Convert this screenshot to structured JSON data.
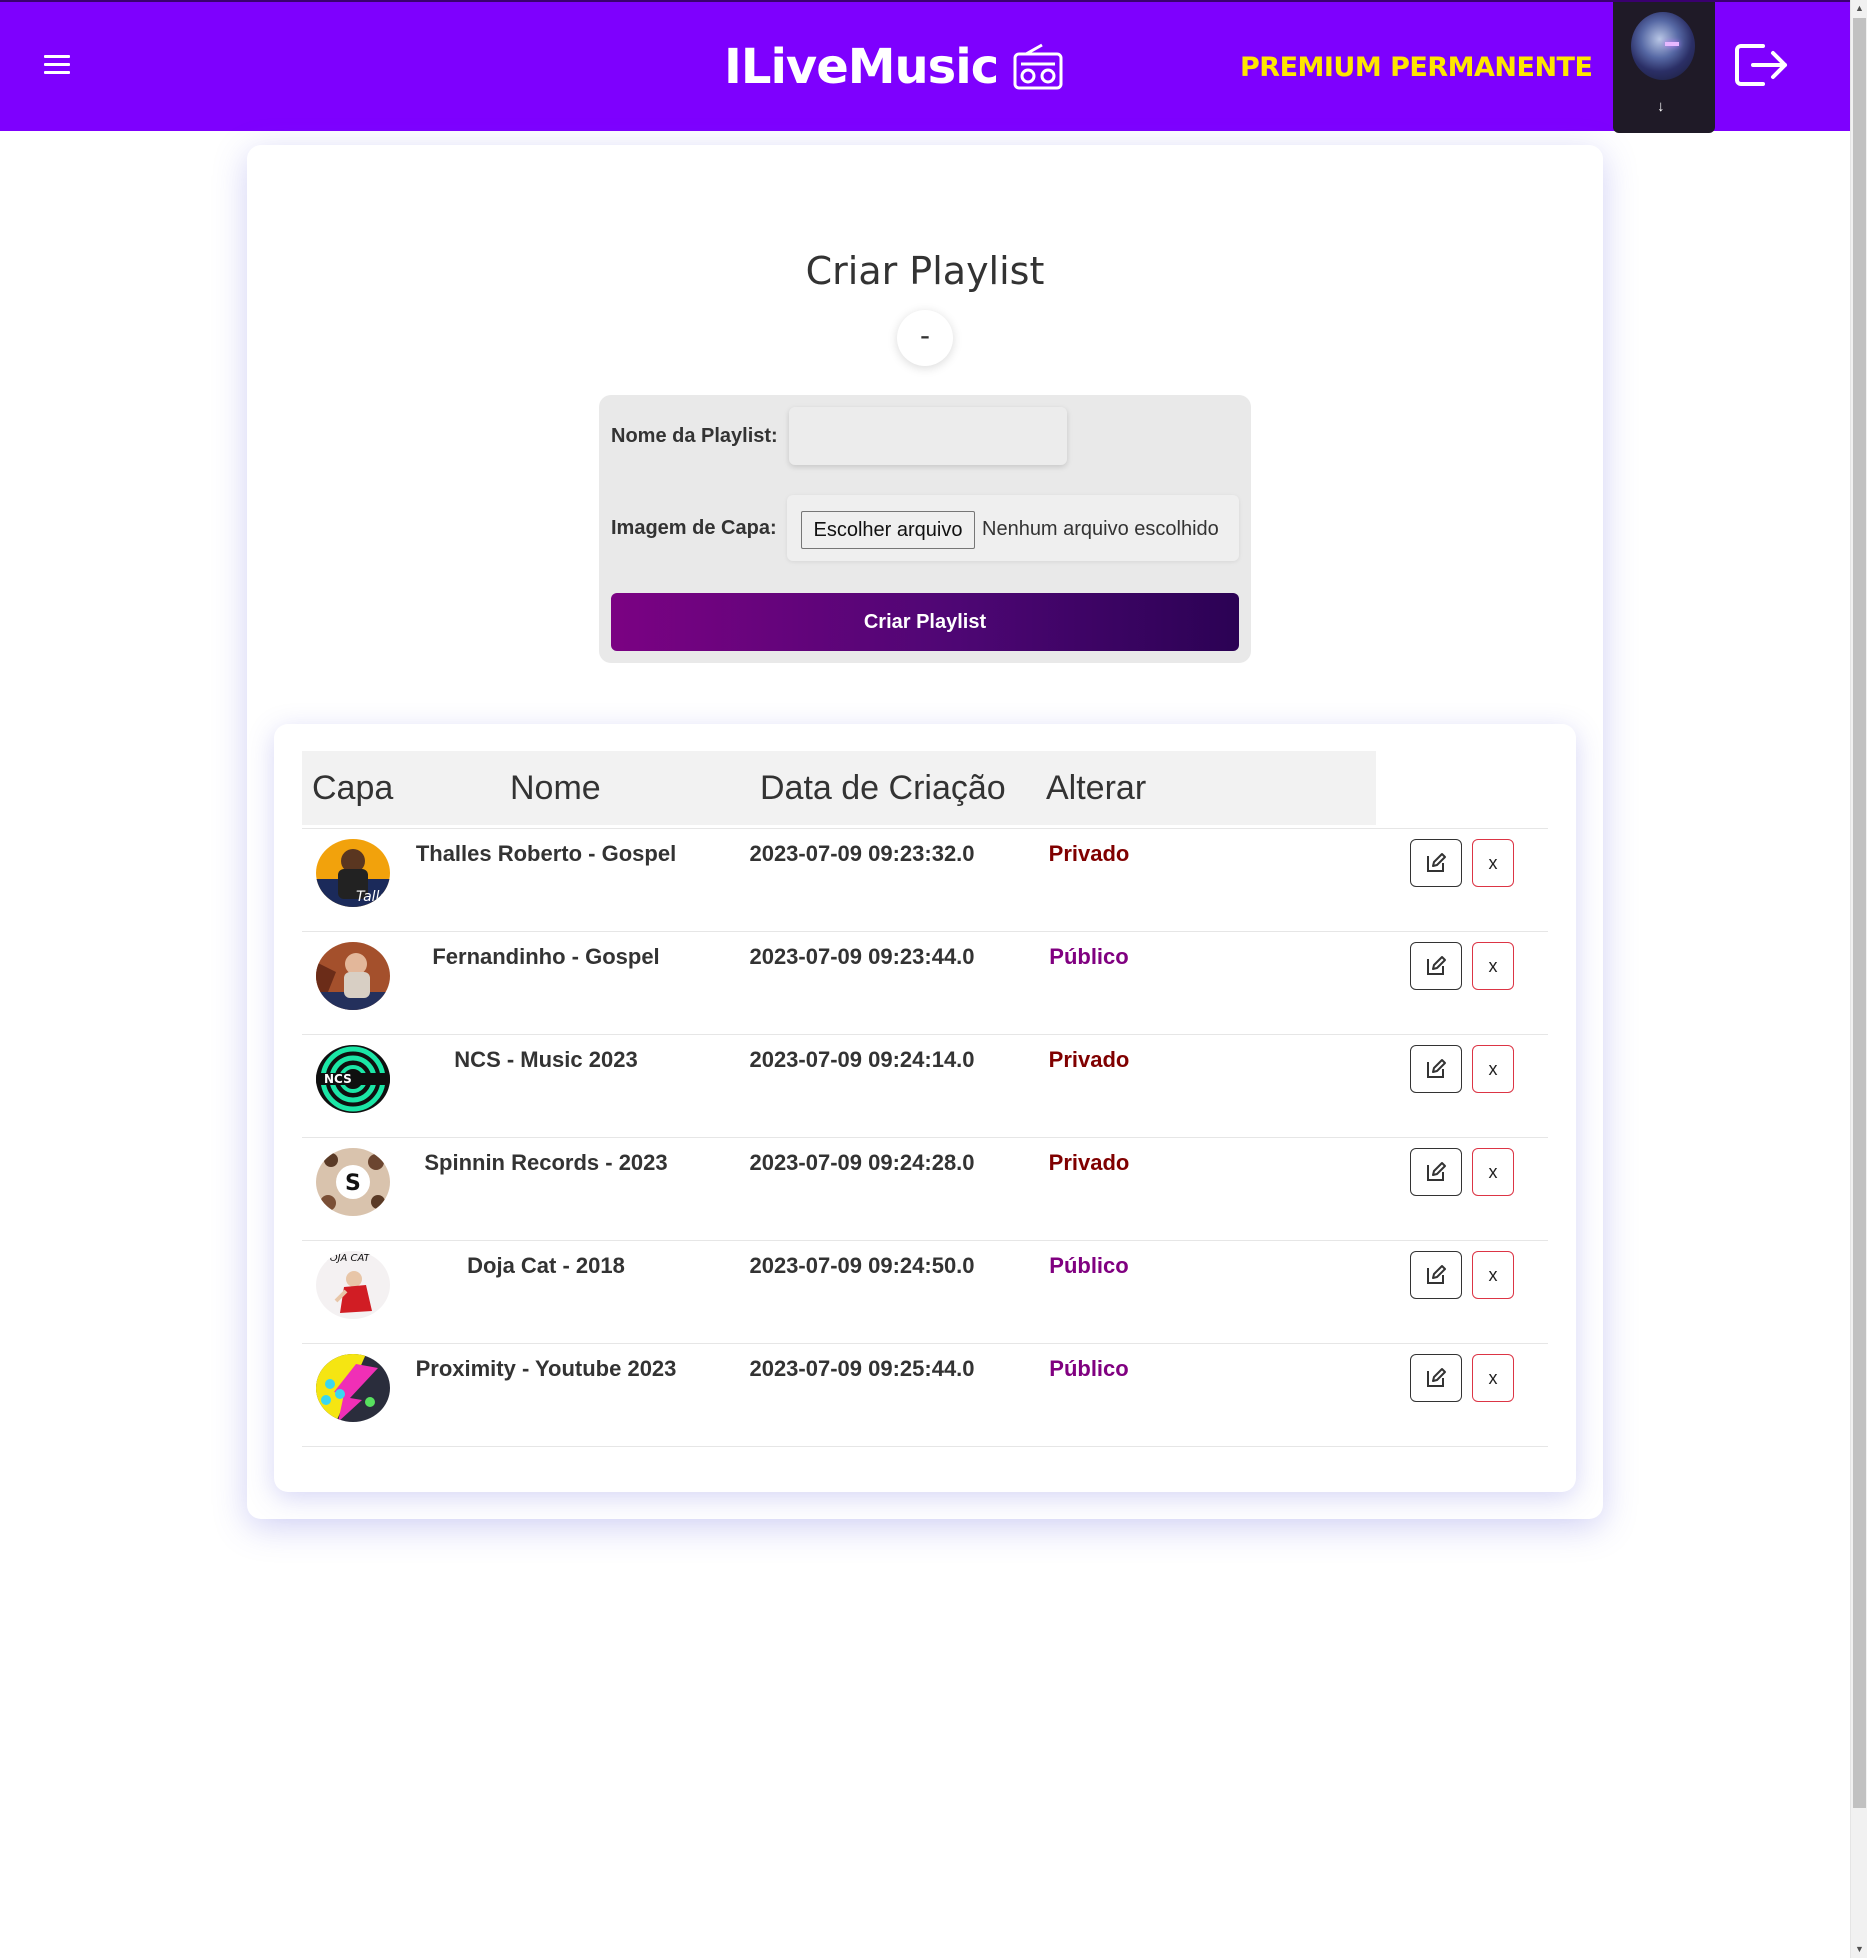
{
  "header": {
    "brand": "ILiveMusic",
    "plan": "PREMIUM PERMANENTE",
    "avatar_arrow": "↓"
  },
  "page": {
    "title": "Criar Playlist",
    "toggle_label": "-"
  },
  "form": {
    "name_label": "Nome da Playlist:",
    "name_value": "",
    "cover_label": "Imagem de Capa:",
    "file_button": "Escolher arquivo",
    "file_status": "Nenhum arquivo escolhido",
    "submit": "Criar Playlist"
  },
  "table": {
    "headers": [
      "Capa",
      "Nome",
      "Data de Criação",
      "Alterar"
    ],
    "delete_label": "x",
    "rows": [
      {
        "name": "Thalles Roberto - Gospel",
        "date": "2023-07-09 09:23:32.0",
        "status": "Privado",
        "cover": "thalles"
      },
      {
        "name": "Fernandinho - Gospel",
        "date": "2023-07-09 09:23:44.0",
        "status": "Público",
        "cover": "fernandinho"
      },
      {
        "name": "NCS - Music 2023",
        "date": "2023-07-09 09:24:14.0",
        "status": "Privado",
        "cover": "ncs"
      },
      {
        "name": "Spinnin Records - 2023",
        "date": "2023-07-09 09:24:28.0",
        "status": "Privado",
        "cover": "spinnin"
      },
      {
        "name": "Doja Cat - 2018",
        "date": "2023-07-09 09:24:50.0",
        "status": "Público",
        "cover": "doja"
      },
      {
        "name": "Proximity - Youtube 2023",
        "date": "2023-07-09 09:25:44.0",
        "status": "Público",
        "cover": "proximity"
      }
    ]
  },
  "colors": {
    "header_bg": "#7e00fe",
    "plan_text": "#ffe600",
    "private": "#800000",
    "public": "#800080",
    "button_gradient_start": "#7b0283",
    "button_gradient_end": "#2b0254"
  }
}
